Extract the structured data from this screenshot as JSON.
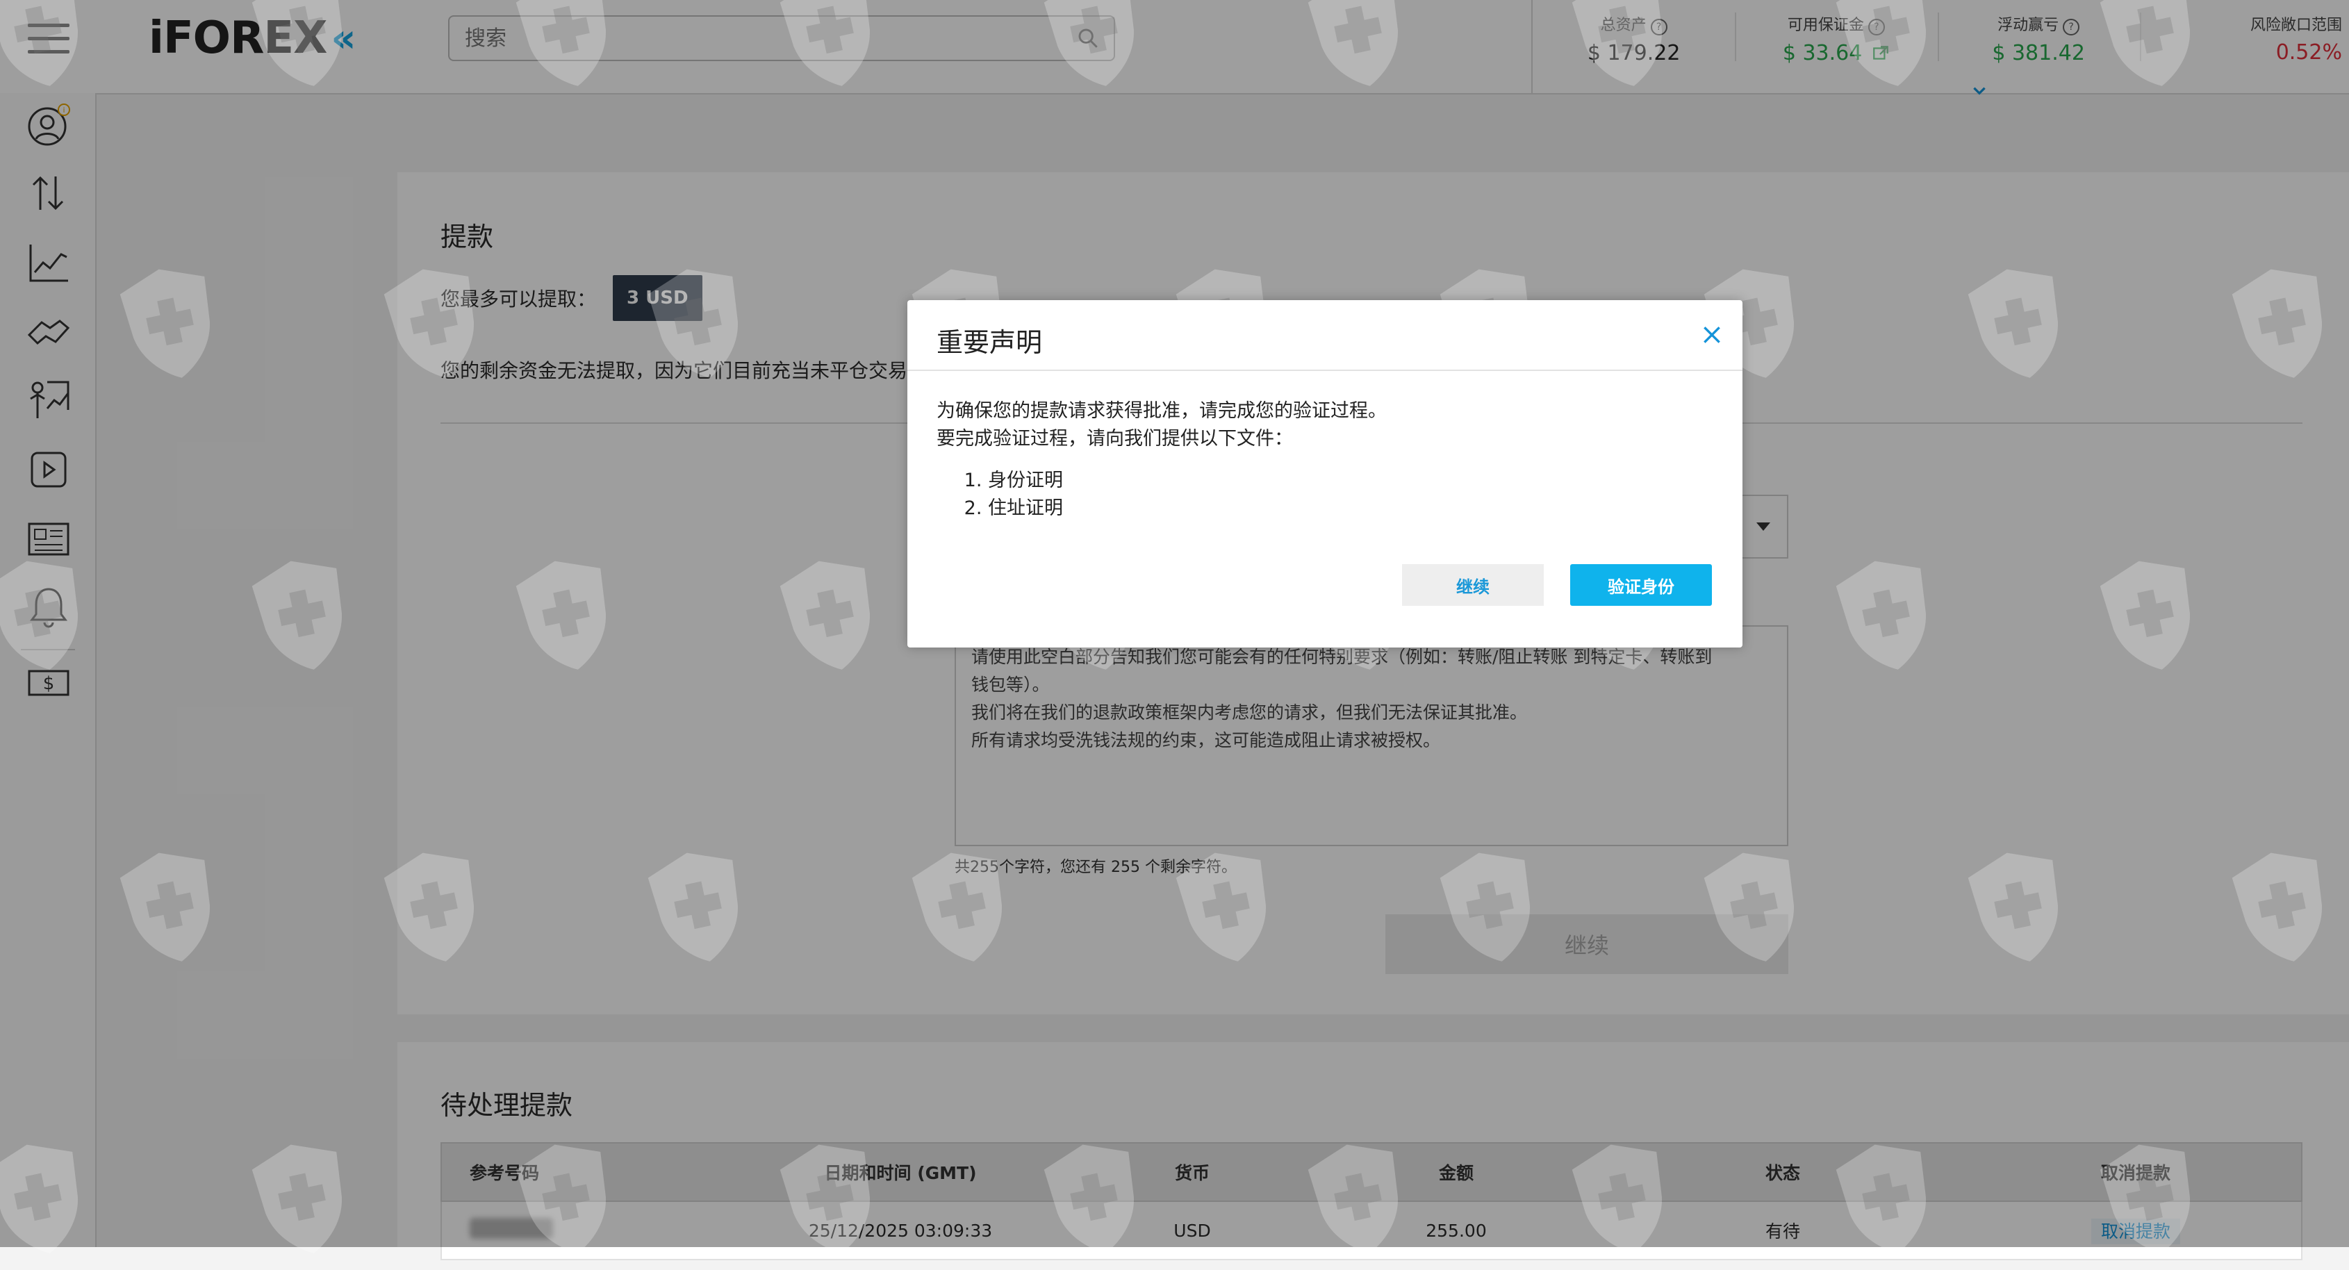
{
  "header": {
    "logo_text": "iFOREX",
    "logo_chevrons": "«",
    "search_placeholder": "搜索",
    "metrics": [
      {
        "label": "总资产",
        "value": "$ 179.22",
        "color": "default"
      },
      {
        "label": "可用保证金",
        "value": "$ 33.64",
        "color": "green"
      },
      {
        "label": "浮动赢亏",
        "value": "$ 381.42",
        "color": "green"
      },
      {
        "label": "风险敞口范围",
        "value": "0.52%",
        "color": "red"
      }
    ]
  },
  "sidebar": {
    "icons": [
      "account-icon",
      "trade-arrows-icon",
      "chart-icon",
      "deals-icon",
      "analysis-icon",
      "video-icon",
      "news-icon",
      "bell-icon",
      "cashier-icon"
    ]
  },
  "withdraw": {
    "title": "提款",
    "max_label": "您最多可以提取：",
    "max_amount": "3 USD",
    "remaining_note": "您的剩余资金无法提取，因为它们目前充当未平仓交易",
    "textarea_lines": [
      "请使用此空白部分告知我们您可能会有的任何特别要求（例如：转账/阻止转账 到特定卡、转账到",
      "钱包等）。",
      "我们将在我们的退款政策框架内考虑您的请求，但我们无法保证其批准。",
      "所有请求均受洗钱法规的约束，这可能造成阻止请求被授权。"
    ],
    "char_count": "共255个字符，您还有 255 个剩余字符。",
    "continue_label": "继续"
  },
  "pending": {
    "title": "待处理提款",
    "columns": [
      "参考号码",
      "日期和时间 (GMT)",
      "货币",
      "金额",
      "状态",
      "取消提款"
    ],
    "rows": [
      {
        "date": "25/12/2025 03:09:33",
        "currency": "USD",
        "amount": "255.00",
        "status": "有待",
        "cancel": "取消提款"
      }
    ]
  },
  "modal": {
    "title": "重要声明",
    "line1": "为确保您的提款请求获得批准，请完成您的验证过程。",
    "line2": "要完成验证过程，请向我们提供以下文件：",
    "items": [
      "身份证明",
      "住址证明"
    ],
    "continue_label": "继续",
    "verify_label": "验证身份"
  },
  "colors": {
    "accent": "#0fb3ec",
    "link": "#1493d9",
    "green": "#29a84e",
    "red": "#e0303b",
    "badge_bg": "#2f3d4c"
  }
}
